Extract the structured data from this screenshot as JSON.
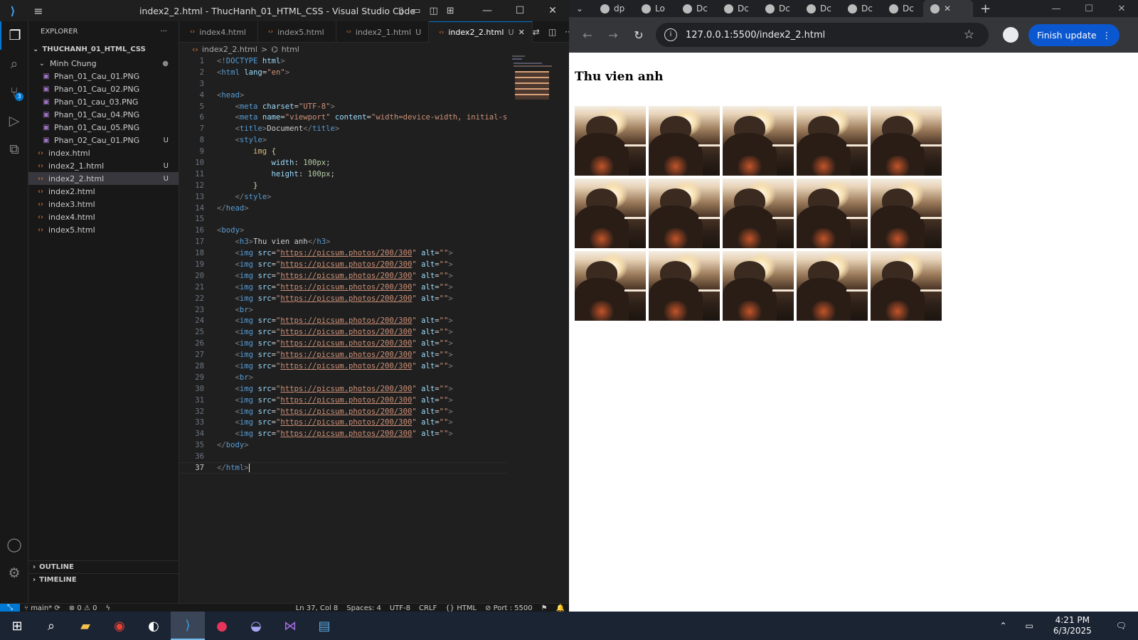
{
  "vscode": {
    "title": "index2_2.html - ThucHanh_01_HTML_CSS - Visual Studio Code",
    "explorer_label": "EXPLORER",
    "more": "···",
    "workspace": "THUCHANH_01_HTML_CSS",
    "folder": "Minh Chung",
    "files": [
      {
        "name": "Phan_01_Cau_01.PNG",
        "status": "",
        "type": "img"
      },
      {
        "name": "Phan_01_Cau_02.PNG",
        "status": "",
        "type": "img"
      },
      {
        "name": "Phan_01_cau_03.PNG",
        "status": "",
        "type": "img"
      },
      {
        "name": "Phan_01_Cau_04.PNG",
        "status": "",
        "type": "img"
      },
      {
        "name": "Phan_01_Cau_05.PNG",
        "status": "",
        "type": "img"
      },
      {
        "name": "Phan_02_Cau_01.PNG",
        "status": "U",
        "type": "img"
      }
    ],
    "root_files": [
      {
        "name": "index.html",
        "status": ""
      },
      {
        "name": "index2_1.html",
        "status": "U"
      },
      {
        "name": "index2_2.html",
        "status": "U",
        "selected": true
      },
      {
        "name": "index2.html",
        "status": ""
      },
      {
        "name": "index3.html",
        "status": ""
      },
      {
        "name": "index4.html",
        "status": ""
      },
      {
        "name": "index5.html",
        "status": ""
      }
    ],
    "outline": "OUTLINE",
    "timeline": "TIMELINE",
    "tabs": [
      {
        "label": "index4.html",
        "dirty": ""
      },
      {
        "label": "index5.html",
        "dirty": ""
      },
      {
        "label": "index2_1.html",
        "dirty": "U"
      },
      {
        "label": "index2_2.html",
        "dirty": "U",
        "active": true
      }
    ],
    "breadcrumb": {
      "file": "index2_2.html",
      "sep": ">",
      "symbol": "html"
    },
    "status": {
      "branch": "main*",
      "errors": "0",
      "warnings": "0",
      "position": "Ln 37, Col 8",
      "spaces": "Spaces: 4",
      "encoding": "UTF-8",
      "eol": "CRLF",
      "lang": "HTML",
      "port": "Port : 5500"
    }
  },
  "browser": {
    "tabs": [
      "dp",
      "Lo",
      "Dc",
      "Dc",
      "Dc",
      "Dc",
      "Dc",
      "Dc"
    ],
    "url": "127.0.0.1:5500/index2_2.html",
    "finish": "Finish update",
    "heading": "Thu vien anh"
  },
  "taskbar": {
    "time": "4:21 PM",
    "date": "6/3/2025"
  }
}
